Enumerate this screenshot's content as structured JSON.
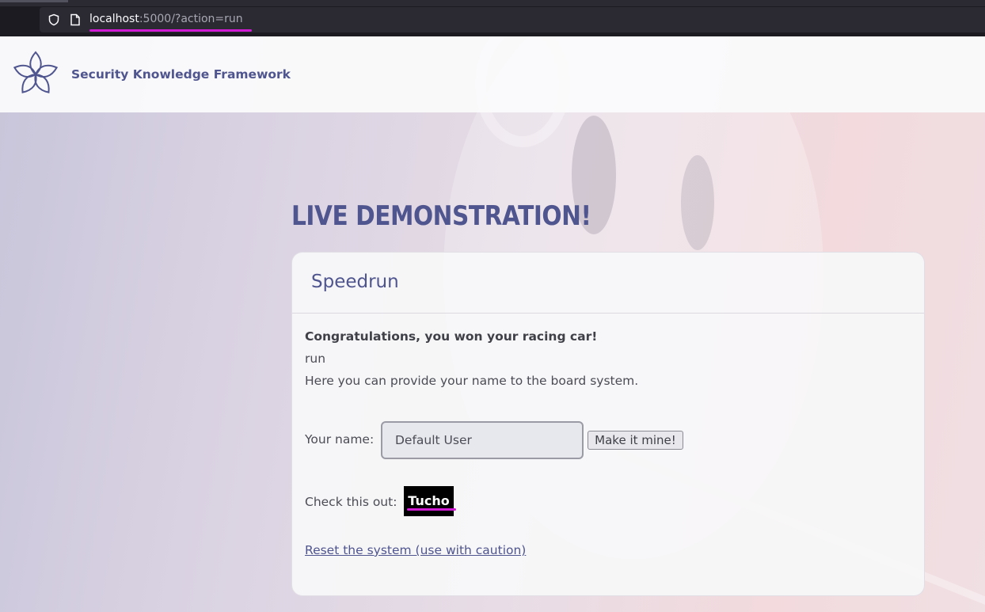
{
  "browser": {
    "url_host": "localhost",
    "url_rest": ":5000/?action=run"
  },
  "site": {
    "brand": "Security Knowledge Framework"
  },
  "main": {
    "headline": "LIVE DEMONSTRATION!",
    "card": {
      "title": "Speedrun",
      "congrats": "Congratulations, you won your racing car!",
      "action_echo": "run",
      "info": "Here you can provide your name to the board system.",
      "name_label": "Your name:",
      "name_placeholder": "Default User",
      "submit_label": "Make it mine!",
      "check_label": "Check this out:",
      "highlight_name": "Tucho",
      "reset_link": "Reset the system (use with caution)"
    }
  },
  "colors": {
    "brand": "#4f558e",
    "annotation_underline": "#d01ad4"
  }
}
